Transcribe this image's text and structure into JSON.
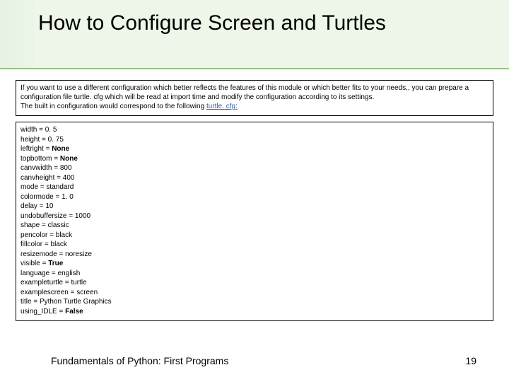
{
  "title": "How to Configure Screen and Turtles",
  "intro": {
    "p1": "If you want to use a different configuration which better reflects the features of this module or which better fits to your needs,, you can prepare a configuration file turtle. cfg which will be read at import time and modify the configuration according to its settings.",
    "p2_pre": "The built in configuration would correspond to the following ",
    "p2_link": "turtle. cfg:"
  },
  "config": [
    {
      "key": "width",
      "value": "0. 5"
    },
    {
      "key": "height",
      "value": "0. 75"
    },
    {
      "key": "leftright",
      "value": "None",
      "bold": true
    },
    {
      "key": "topbottom",
      "value": "None",
      "bold": true
    },
    {
      "key": "canvwidth",
      "value": "800"
    },
    {
      "key": "canvheight",
      "value": "400"
    },
    {
      "key": "mode",
      "value": "standard"
    },
    {
      "key": "colormode",
      "value": "1. 0"
    },
    {
      "key": "delay",
      "value": "10"
    },
    {
      "key": "undobuffersize",
      "value": "1000"
    },
    {
      "key": "shape",
      "value": "classic"
    },
    {
      "key": "pencolor",
      "value": "black"
    },
    {
      "key": "fillcolor",
      "value": "black"
    },
    {
      "key": "resizemode",
      "value": "noresize"
    },
    {
      "key": "visible",
      "value": "True",
      "bold": true
    },
    {
      "key": "language",
      "value": "english"
    },
    {
      "key": "exampleturtle",
      "value": "turtle"
    },
    {
      "key": "examplescreen",
      "value": "screen"
    },
    {
      "key": "title",
      "value": "Python Turtle Graphics"
    },
    {
      "key": "using_IDLE",
      "value": "False",
      "bold": true
    }
  ],
  "footer": {
    "left": "Fundamentals of Python: First Programs",
    "right": "19"
  }
}
